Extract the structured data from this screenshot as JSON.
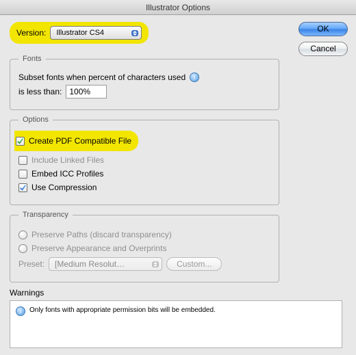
{
  "title": "Illustrator Options",
  "buttons": {
    "ok": "OK",
    "cancel": "Cancel"
  },
  "version": {
    "label": "Version:",
    "value": "Illustrator CS4"
  },
  "fonts": {
    "legend": "Fonts",
    "line1": "Subset fonts when percent of characters used",
    "line2": "is less than:",
    "value": "100%"
  },
  "options": {
    "legend": "Options",
    "pdf": "Create PDF Compatible File",
    "linked": "Include Linked Files",
    "icc": "Embed ICC Profiles",
    "compress": "Use Compression"
  },
  "transparency": {
    "legend": "Transparency",
    "paths": "Preserve Paths (discard transparency)",
    "appearance": "Preserve Appearance and Overprints",
    "preset_label": "Preset:",
    "preset_value": "[Medium Resolut…",
    "custom": "Custom..."
  },
  "warnings": {
    "label": "Warnings",
    "msg": "Only fonts with appropriate permission bits will be embedded."
  }
}
